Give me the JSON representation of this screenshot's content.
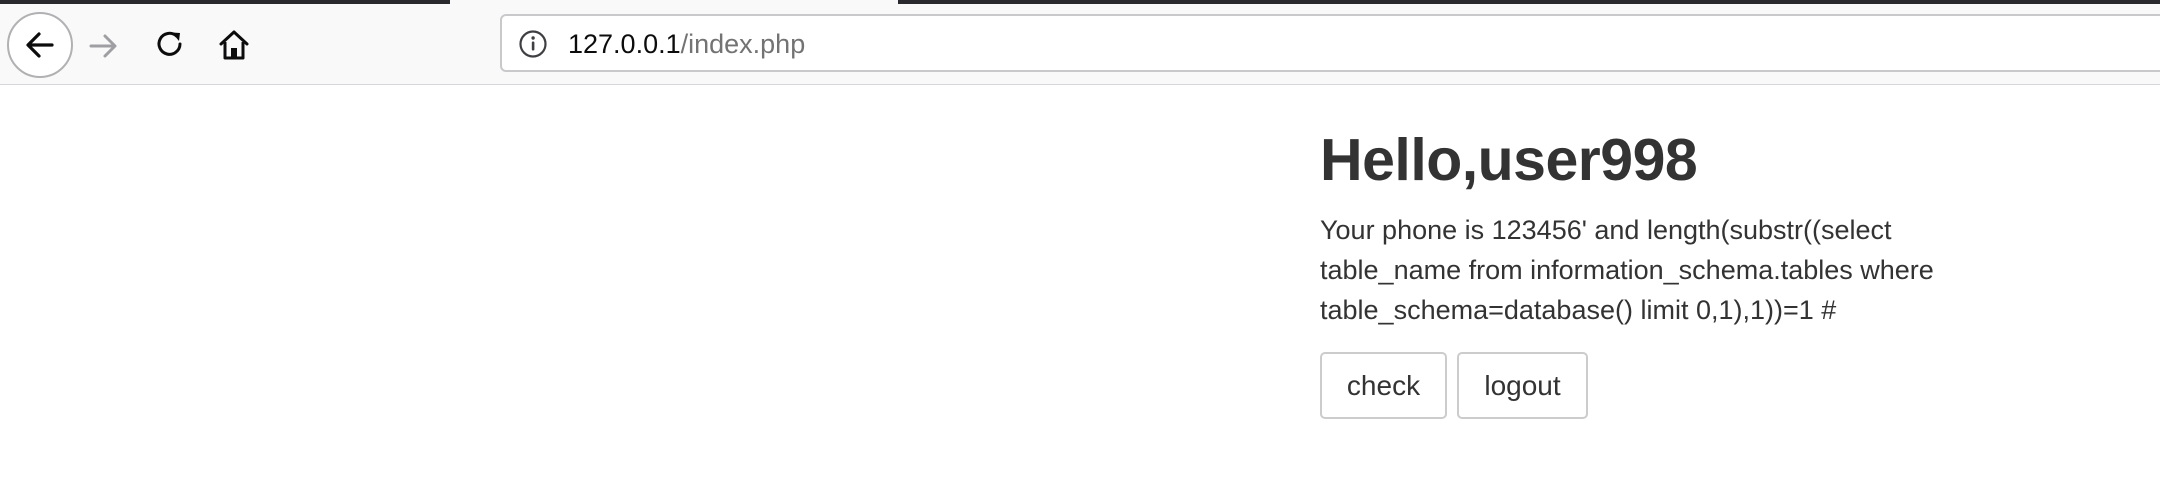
{
  "browser": {
    "url_host": "127.0.0.1",
    "url_path": "/index.php",
    "icons": {
      "back": "arrow-left-icon",
      "forward": "arrow-right-icon",
      "reload": "reload-icon",
      "home": "home-icon",
      "info": "info-icon"
    },
    "colors": {
      "chrome_bg": "#f9f9fa",
      "tab_line": "#2a2a2e"
    }
  },
  "page": {
    "greeting": "Hello,user998",
    "phone_text": "Your phone is 123456' and length(substr((select table_name from information_schema.tables where table_schema=database() limit 0,1),1))=1 #",
    "buttons": {
      "check_label": "check",
      "logout_label": "logout"
    }
  }
}
